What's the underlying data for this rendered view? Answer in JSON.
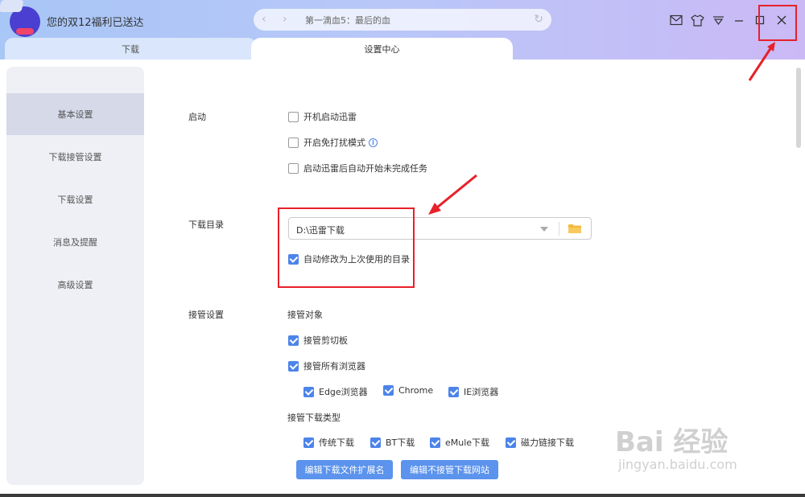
{
  "titlebar": {
    "promo_text": "您的双12福利已送达",
    "url_text": "第一滴血5：最后的血",
    "nav_back": "‹",
    "nav_forward": "›",
    "refresh": "↻"
  },
  "tabs": [
    {
      "label": "下载"
    },
    {
      "label": "设置中心"
    }
  ],
  "sidebar": {
    "items": [
      {
        "label": "基本设置",
        "active": true
      },
      {
        "label": "下载接管设置"
      },
      {
        "label": "下载设置"
      },
      {
        "label": "消息及提醒"
      },
      {
        "label": "高级设置"
      }
    ]
  },
  "startup": {
    "label": "启动",
    "options": [
      {
        "label": "开机启动迅雷",
        "checked": false
      },
      {
        "label": "开启免打扰模式",
        "checked": false
      },
      {
        "label": "启动迅雷后自动开始未完成任务",
        "checked": false
      }
    ],
    "info_icon": "i"
  },
  "download_dir": {
    "label": "下载目录",
    "path": "D:\\迅雷下载",
    "auto_modify_label": "自动修改为上次使用的目录",
    "auto_modify_checked": true
  },
  "takeover": {
    "label": "接管设置",
    "target_label": "接管对象",
    "clipboard_label": "接管剪切板",
    "all_browsers_label": "接管所有浏览器",
    "browsers": [
      "Edge浏览器",
      "Chrome",
      "IE浏览器"
    ],
    "types_label": "接管下载类型",
    "types": [
      "传统下载",
      "BT下载",
      "eMule下载",
      "磁力链接下载"
    ],
    "edit_ext_button": "编辑下载文件扩展名",
    "edit_sites_button": "编辑不接管下载网站"
  },
  "watermark": {
    "logo": "Bai 经验",
    "url": "jingyan.baidu.com"
  },
  "colors": {
    "accent": "#4c84ea",
    "annotation": "#e8202a"
  }
}
